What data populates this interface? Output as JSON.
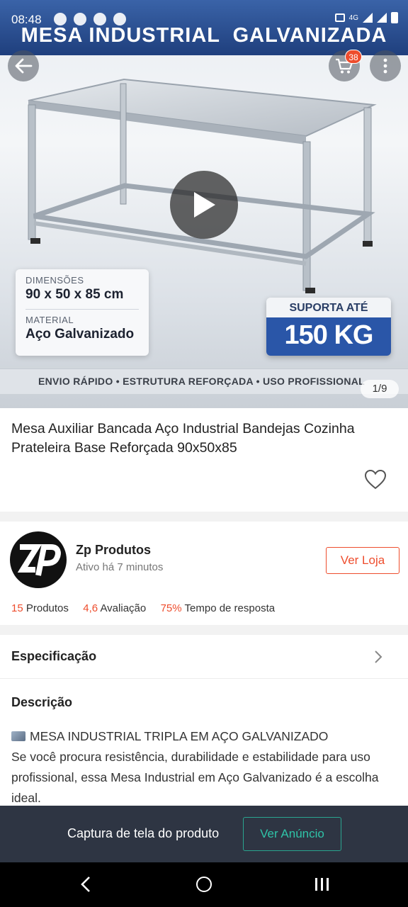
{
  "status_bar": {
    "time": "08:48",
    "network": "4G"
  },
  "hero": {
    "banner_title": "MESA INDUSTRIAL  GALVANIZADA",
    "cart_badge": "38",
    "spec_card": {
      "dimension_label": "DIMENSÕES",
      "dimension_value": "90 x 50 x 85 cm",
      "material_label": "MATERIAL",
      "material_value": "Aço Galvanizado"
    },
    "weight_card": {
      "top": "SUPORTA ATÉ",
      "value": "150 KG"
    },
    "features": "ENVIO RÁPIDO • ESTRUTURA REFORÇADA • USO PROFISSIONAL",
    "page_indicator": "1/9"
  },
  "product": {
    "title": "Mesa Auxiliar Bancada Aço Industrial Bandejas Cozinha Prateleira Base Reforçada 90x50x85"
  },
  "shop": {
    "name": "Zp Produtos",
    "active_status": "Ativo há 7 minutos",
    "visit_button": "Ver Loja",
    "stats": {
      "products_count": "15",
      "products_label": "Produtos",
      "rating": "4,6",
      "rating_label": "Avaliação",
      "response_rate": "75%",
      "response_label": "Tempo de resposta"
    }
  },
  "specification": {
    "label": "Especificação"
  },
  "description": {
    "heading": "Descrição",
    "line1": "MESA INDUSTRIAL TRIPLA EM AÇO GALVANIZADO",
    "body": "Se você procura resistência, durabilidade e estabilidade para uso profissional, essa Mesa Industrial em Aço Galvanizado é a escolha ideal."
  },
  "capture_bar": {
    "text": "Captura de tela do produto",
    "button": "Ver Anúncio"
  },
  "colors": {
    "accent": "#ee4d2d",
    "capture_bar": "#2e3543",
    "capture_button": "#2fc4a8",
    "banner": "#1f3f7d"
  },
  "icons": [
    "back-arrow-icon",
    "cart-icon",
    "more-icon",
    "play-icon",
    "heart-icon",
    "chevron-right-icon",
    "nav-back-icon",
    "nav-home-icon",
    "nav-recents-icon"
  ]
}
